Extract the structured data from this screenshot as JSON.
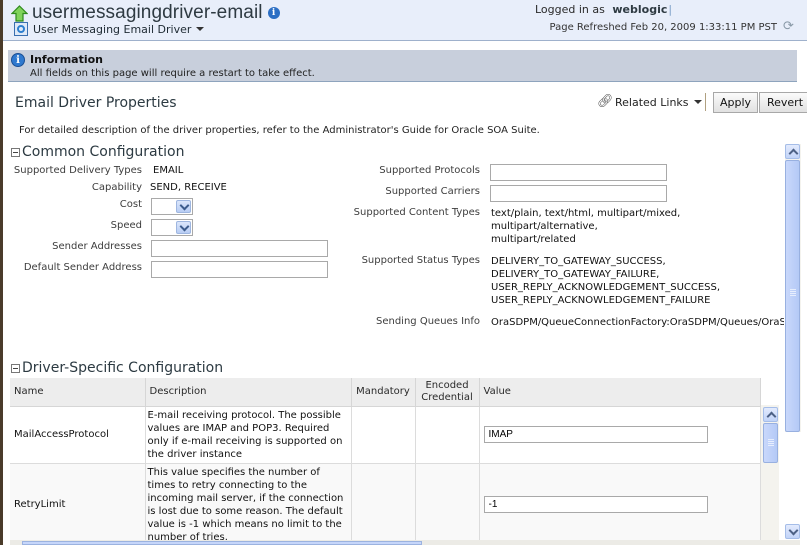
{
  "header": {
    "title": "usermessagingdriver-email",
    "target_menu": "User Messaging Email Driver",
    "logged_in_label": "Logged in as",
    "user": "weblogic",
    "page_refreshed": "Page Refreshed Feb 20, 2009 1:33:11 PM PST"
  },
  "info_banner": {
    "title": "Information",
    "message": "All fields on this page will require a restart to take effect."
  },
  "page": {
    "section_title": "Email Driver Properties",
    "related_links": "Related Links",
    "apply_label": "Apply",
    "revert_label": "Revert",
    "description": "For detailed description of the driver properties, refer to the Administrator's Guide for Oracle SOA Suite."
  },
  "common_config": {
    "title": "Common Configuration",
    "left_fields": [
      {
        "label": "Supported Delivery Types",
        "value": "EMAIL"
      },
      {
        "label": "Capability",
        "value": "SEND, RECEIVE"
      },
      {
        "label": "Cost",
        "value": ""
      },
      {
        "label": "Speed",
        "value": ""
      },
      {
        "label": "Sender Addresses",
        "value": ""
      },
      {
        "label": "Default Sender Address",
        "value": ""
      }
    ],
    "right_fields": [
      {
        "label": "Supported Protocols",
        "value": ""
      },
      {
        "label": "Supported Carriers",
        "value": ""
      },
      {
        "label": "Supported Content Types",
        "value": "text/plain, text/html, multipart/mixed, multipart/alternative, multipart/related"
      },
      {
        "label": "Supported Status Types",
        "value": "DELIVERY_TO_GATEWAY_SUCCESS, DELIVERY_TO_GATEWAY_FAILURE, USER_REPLY_ACKNOWLEDGEMENT_SUCCESS, USER_REPLY_ACKNOWLEDGEMENT_FAILURE"
      },
      {
        "label": "Sending Queues Info",
        "value": "OraSDPM/QueueConnectionFactory:OraSDPM/Queues/OraSI"
      }
    ],
    "content_types_lines": [
      "text/plain, text/html, multipart/mixed, multipart/alternative,",
      "multipart/related"
    ],
    "status_types_lines": [
      "DELIVERY_TO_GATEWAY_SUCCESS,",
      "DELIVERY_TO_GATEWAY_FAILURE,",
      "USER_REPLY_ACKNOWLEDGEMENT_SUCCESS,",
      "USER_REPLY_ACKNOWLEDGEMENT_FAILURE"
    ]
  },
  "driver_config": {
    "title": "Driver-Specific Configuration",
    "columns": [
      "Name",
      "Description",
      "Mandatory",
      "Encoded Credential",
      "Value"
    ],
    "rows": [
      {
        "name": "MailAccessProtocol",
        "description": " E-mail receiving protocol. The possible values are IMAP and POP3. Required only if e-mail receiving is supported on the driver instance",
        "mandatory": "",
        "encoded_credential": "",
        "value": "IMAP"
      },
      {
        "name": "RetryLimit",
        "description": " This value specifies the number of times to retry connecting to the incoming mail server, if the connection is lost due to some reason. The default value is -1 which means no limit to the number of tries.",
        "mandatory": "",
        "encoded_credential": "",
        "value": "-1"
      }
    ]
  },
  "icons": {
    "up": "up-arrow-icon",
    "info": "info-icon",
    "target": "target-icon",
    "refresh": "refresh-icon",
    "link": "chain-link-icon"
  }
}
